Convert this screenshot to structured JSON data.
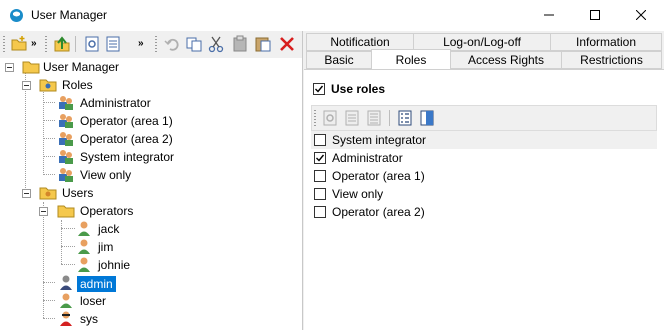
{
  "window": {
    "title": "User Manager"
  },
  "tree": {
    "root": "User Manager",
    "roles_group": "Roles",
    "roles": [
      "Administrator",
      "Operator (area 1)",
      "Operator (area 2)",
      "System integrator",
      "View only"
    ],
    "users_group": "Users",
    "operators_group": "Operators",
    "operators": [
      "jack",
      "jim",
      "johnie"
    ],
    "users": [
      "admin",
      "loser",
      "sys"
    ],
    "selected": "admin"
  },
  "tabs": {
    "top_row": [
      "Notification",
      "Log-on/Log-off",
      "Information"
    ],
    "bottom_row": [
      "Basic",
      "Roles",
      "Access Rights",
      "Restrictions"
    ],
    "active": "Roles"
  },
  "roles_panel": {
    "use_roles_label": "Use roles",
    "use_roles_checked": true,
    "roles": [
      {
        "name": "System integrator",
        "checked": false
      },
      {
        "name": "Administrator",
        "checked": true
      },
      {
        "name": "Operator (area 1)",
        "checked": false
      },
      {
        "name": "View only",
        "checked": false
      },
      {
        "name": "Operator (area 2)",
        "checked": false
      }
    ]
  },
  "colors": {
    "selection": "#0078d7",
    "close_red": "#e81123",
    "folder": "#f5c84c"
  }
}
